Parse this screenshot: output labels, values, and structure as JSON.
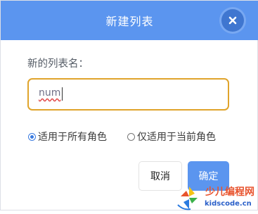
{
  "dialog": {
    "title": "新建列表",
    "close_icon": "close-icon"
  },
  "form": {
    "prompt_label": "新的列表名：",
    "list_name_value": "num"
  },
  "scope": {
    "options": [
      {
        "label": "适用于所有角色",
        "selected": true
      },
      {
        "label": "仅适用于当前角色",
        "selected": false
      }
    ]
  },
  "actions": {
    "cancel_label": "取消",
    "ok_label": "确定"
  },
  "watermark": {
    "brand": "少儿编程网",
    "url": "kidscode.cn"
  },
  "colors": {
    "header": "#5b95ef",
    "input_border": "#e0a42b",
    "primary": "#5b95ef"
  }
}
